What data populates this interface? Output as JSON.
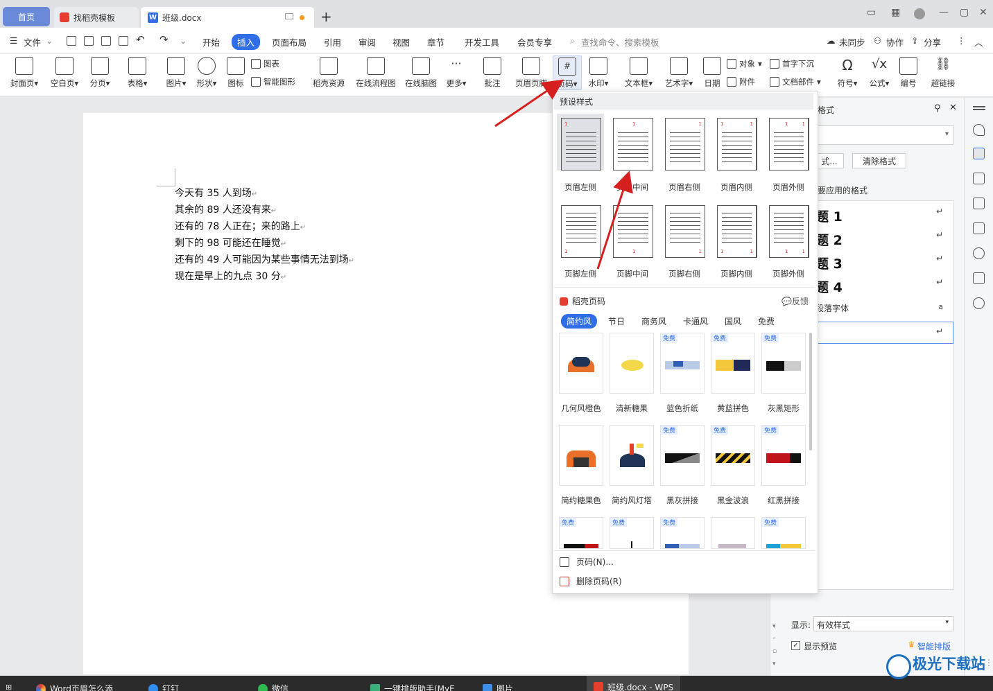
{
  "tabs": {
    "home": "首页",
    "template": "找稻壳模板",
    "doc": "班级.docx"
  },
  "menu": {
    "file": "文件",
    "items": [
      "开始",
      "插入",
      "页面布局",
      "引用",
      "审阅",
      "视图",
      "章节",
      "开发工具",
      "会员专享"
    ],
    "search": "查找命令、搜索模板",
    "sync": "未同步",
    "collab": "协作",
    "share": "分享"
  },
  "ribbon": {
    "cover": "封面页",
    "blank": "空白页",
    "pagebreak": "分页",
    "table": "表格",
    "picture": "图片",
    "shape": "形状",
    "icon": "图标",
    "chart": "图表",
    "smartart": "智能图形",
    "docer": "稻壳资源",
    "flow": "在线流程图",
    "mind": "在线脑图",
    "more": "更多",
    "comment": "批注",
    "headerfooter": "页眉页脚",
    "pagenum": "页码",
    "watermark": "水印",
    "textbox": "文本框",
    "arttext": "艺术字",
    "date": "日期",
    "object": "对象",
    "attachment": "附件",
    "dropcap": "首字下沉",
    "docpart": "文档部件",
    "symbol": "符号",
    "formula": "公式",
    "numbering": "编号",
    "hyperlink": "超链接"
  },
  "document": {
    "lines": [
      "今天有 35 人到场",
      "其余的 89 人还没有来",
      "还有的 78 人正在；来的路上",
      "剩下的 98 可能还在睡觉",
      "还有的 49 人可能因为某些事情无法到场",
      "现在是早上的九点 30 分"
    ],
    "para_mark": "↵"
  },
  "sidepanel": {
    "title_fragment": "格式",
    "btn_fragment": "式...",
    "clear": "清除格式",
    "apply_label": "要应用的格式",
    "styles": [
      "题 1",
      "题 2",
      "题 3",
      "题 4"
    ],
    "para_font": "段落字体",
    "show_label": "显示:",
    "show_value": "有效样式",
    "preview": "显示预览",
    "smart": "智能排版"
  },
  "dropdown": {
    "preset_title": "预设样式",
    "header_presets": [
      "页眉左侧",
      "页眉中间",
      "页眉右侧",
      "页眉内侧",
      "页眉外侧"
    ],
    "footer_presets": [
      "页脚左侧",
      "页脚中间",
      "页脚右侧",
      "页脚内侧",
      "页脚外侧"
    ],
    "docer_title": "稻壳页码",
    "feedback": "反馈",
    "categories": [
      "简约风",
      "节日",
      "商务风",
      "卡通风",
      "国风",
      "免费"
    ],
    "free_badge": "免费",
    "cards_row1": [
      "几何风橙色",
      "清新糖果",
      "蓝色折纸",
      "黄蓝拼色",
      "灰黑矩形"
    ],
    "cards_row2": [
      "简约糖果色",
      "简约风灯塔",
      "黑灰拼接",
      "黑金波浪",
      "红黑拼接"
    ],
    "action_pagenum": "页码(N)...",
    "action_delete": "删除页码(R)"
  },
  "taskbar": {
    "items": [
      "Word页眉怎么添",
      "钉钉",
      "微信",
      "一键排版助手(MyE",
      "图片",
      "班级.docx - WPS"
    ]
  },
  "watermark_text": "极光下载站",
  "colors": {
    "accent": "#2f6ee6",
    "arrow": "#d62020"
  }
}
